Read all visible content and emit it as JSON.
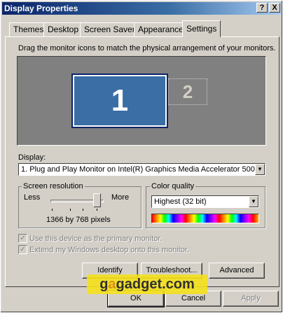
{
  "window": {
    "title": "Display Properties",
    "help_label": "?",
    "close_label": "X"
  },
  "tabs": [
    {
      "label": "Themes"
    },
    {
      "label": "Desktop"
    },
    {
      "label": "Screen Saver"
    },
    {
      "label": "Appearance"
    },
    {
      "label": "Settings"
    }
  ],
  "active_tab": "Settings",
  "settings": {
    "instruction": "Drag the monitor icons to match the physical arrangement of your monitors.",
    "monitors": [
      {
        "number": "1",
        "selected": true
      },
      {
        "number": "2",
        "selected": false
      }
    ],
    "display_label": "Display:",
    "display_value": "1. Plug and Play Monitor on Intel(R) Graphics Media Accelerator 500",
    "resolution": {
      "group_title": "Screen resolution",
      "less_label": "Less",
      "more_label": "More",
      "value_text": "1366 by 768 pixels",
      "slider_level": 1.0
    },
    "color_quality": {
      "group_title": "Color quality",
      "value": "Highest (32 bit)"
    },
    "checkboxes": [
      {
        "label": "Use this device as the primary monitor.",
        "checked": true,
        "enabled": false
      },
      {
        "label": "Extend my Windows desktop onto this monitor.",
        "checked": true,
        "enabled": false
      }
    ],
    "buttons": {
      "identify": "Identify",
      "troubleshoot": "Troubleshoot...",
      "advanced": "Advanced"
    }
  },
  "dialog_buttons": {
    "ok": "OK",
    "cancel": "Cancel",
    "apply": "Apply"
  },
  "watermark": {
    "part1": "g",
    "part2": "a",
    "part3": "gadget.com"
  },
  "colors": {
    "titlebar": "#0a246a",
    "face": "#d4d0c8",
    "monitor_selected": "#3a6ea5",
    "desktop_area": "#808080"
  }
}
